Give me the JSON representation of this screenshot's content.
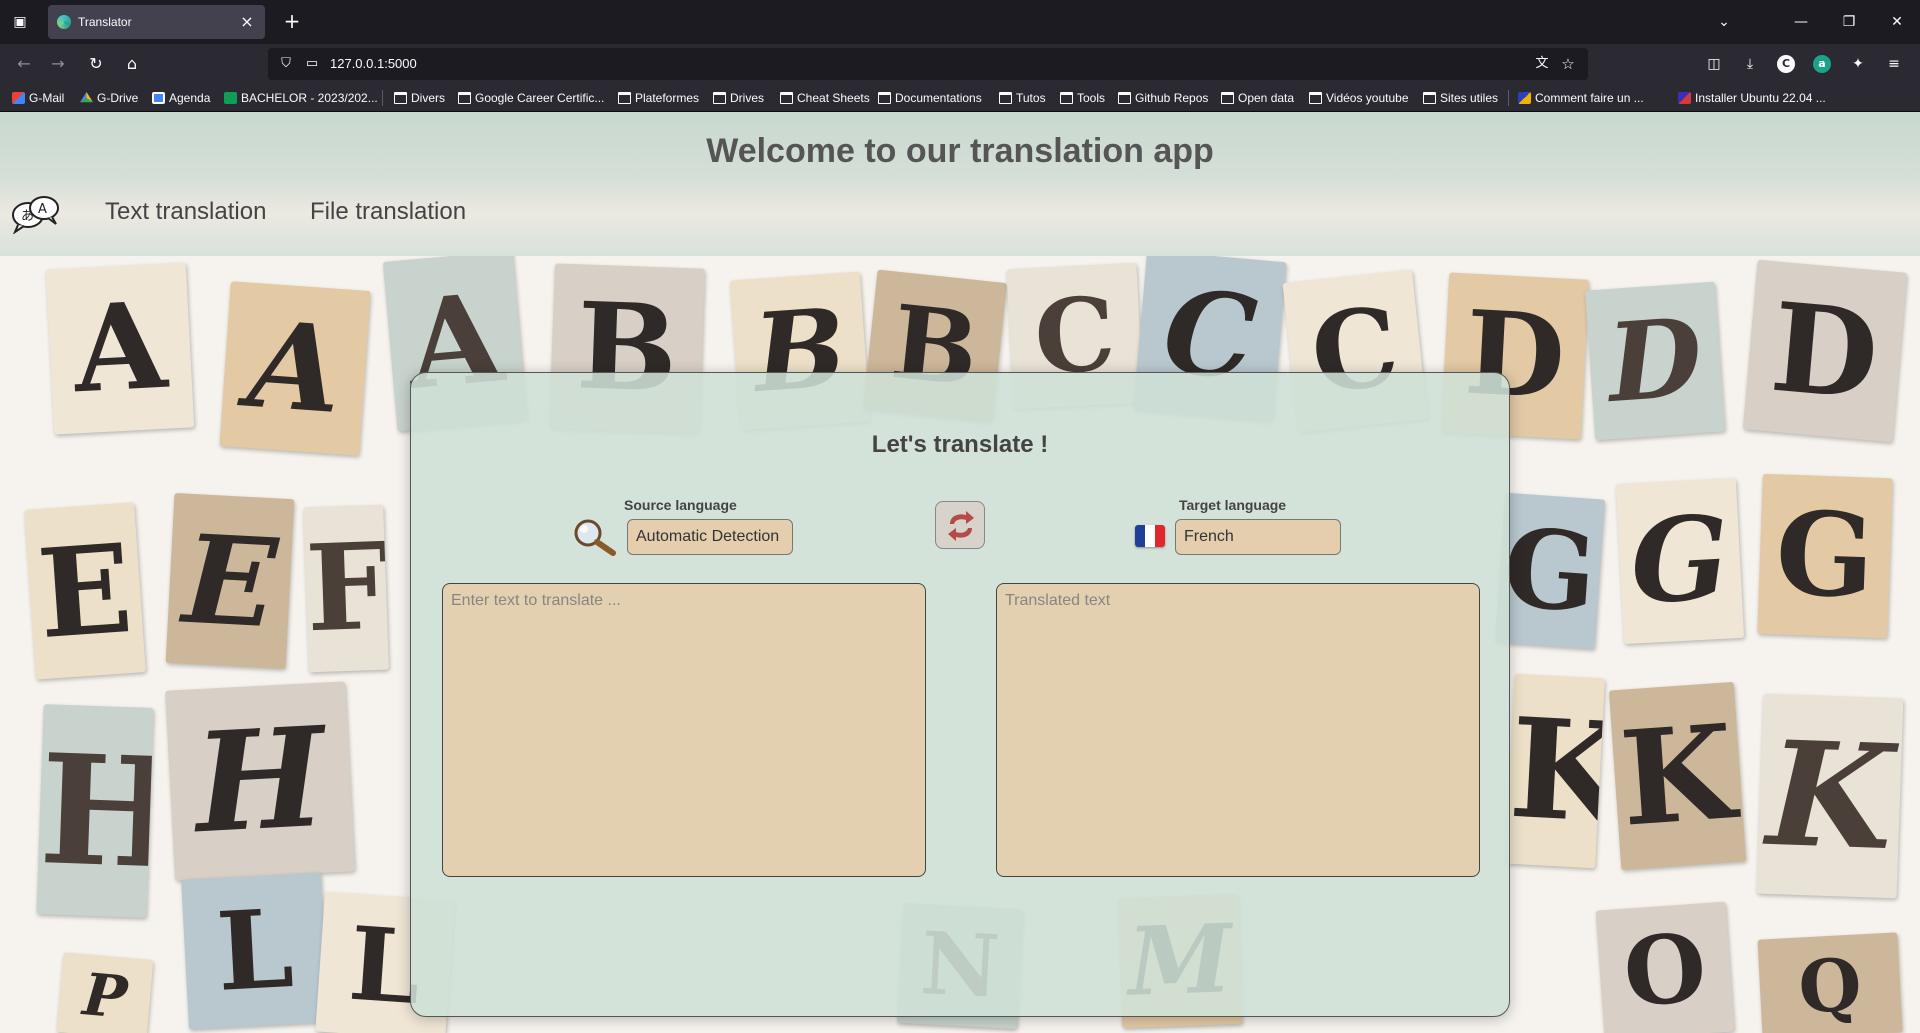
{
  "browser": {
    "tab": {
      "title": "Translator"
    },
    "address": {
      "url": "127.0.0.1:5000"
    },
    "bookmarks": [
      {
        "label": "G-Mail",
        "icon": "gmail-icon"
      },
      {
        "label": "G-Drive",
        "icon": "google-drive-icon"
      },
      {
        "label": "Agenda",
        "icon": "calendar-icon"
      },
      {
        "label": "BACHELOR - 2023/202...",
        "icon": "sheets-icon"
      },
      {
        "label": "Divers",
        "icon": "folder-icon"
      },
      {
        "label": "Google Career Certific...",
        "icon": "folder-icon"
      },
      {
        "label": "Plateformes",
        "icon": "folder-icon"
      },
      {
        "label": "Drives",
        "icon": "folder-icon"
      },
      {
        "label": "Cheat Sheets",
        "icon": "folder-icon"
      },
      {
        "label": "Documentations",
        "icon": "folder-icon"
      },
      {
        "label": "Tutos",
        "icon": "folder-icon"
      },
      {
        "label": "Tools",
        "icon": "folder-icon"
      },
      {
        "label": "Github Repos",
        "icon": "folder-icon"
      },
      {
        "label": "Open data",
        "icon": "folder-icon"
      },
      {
        "label": "Vidéos youtube",
        "icon": "folder-icon"
      },
      {
        "label": "Sites utiles",
        "icon": "folder-icon"
      },
      {
        "label": "Comment faire un ...",
        "icon": "page-icon"
      },
      {
        "label": "Installer Ubuntu 22.04 ...",
        "icon": "page-icon"
      }
    ]
  },
  "header": {
    "title": "Welcome to our translation app",
    "nav": [
      "Text translation",
      "File translation"
    ]
  },
  "translator": {
    "title": "Let's translate !",
    "source": {
      "label": "Source language",
      "value": "Automatic Detection"
    },
    "target": {
      "label": "Target language",
      "value": "French"
    },
    "input_placeholder": "Enter text to translate ...",
    "output_placeholder": "Translated text"
  },
  "colors": {
    "accent": "#e4ceae",
    "panel": "#cee0d6",
    "header": "#c9d8cf",
    "swap_arrows": "#b44a4a"
  },
  "background_letters": [
    "A",
    "A",
    "A",
    "B",
    "B",
    "B",
    "C",
    "C",
    "C",
    "D",
    "D",
    "D",
    "E",
    "E",
    "F",
    "G",
    "G",
    "G",
    "H",
    "H",
    "K",
    "K",
    "K",
    "L",
    "L",
    "M",
    "N",
    "O",
    "P",
    "Q"
  ]
}
